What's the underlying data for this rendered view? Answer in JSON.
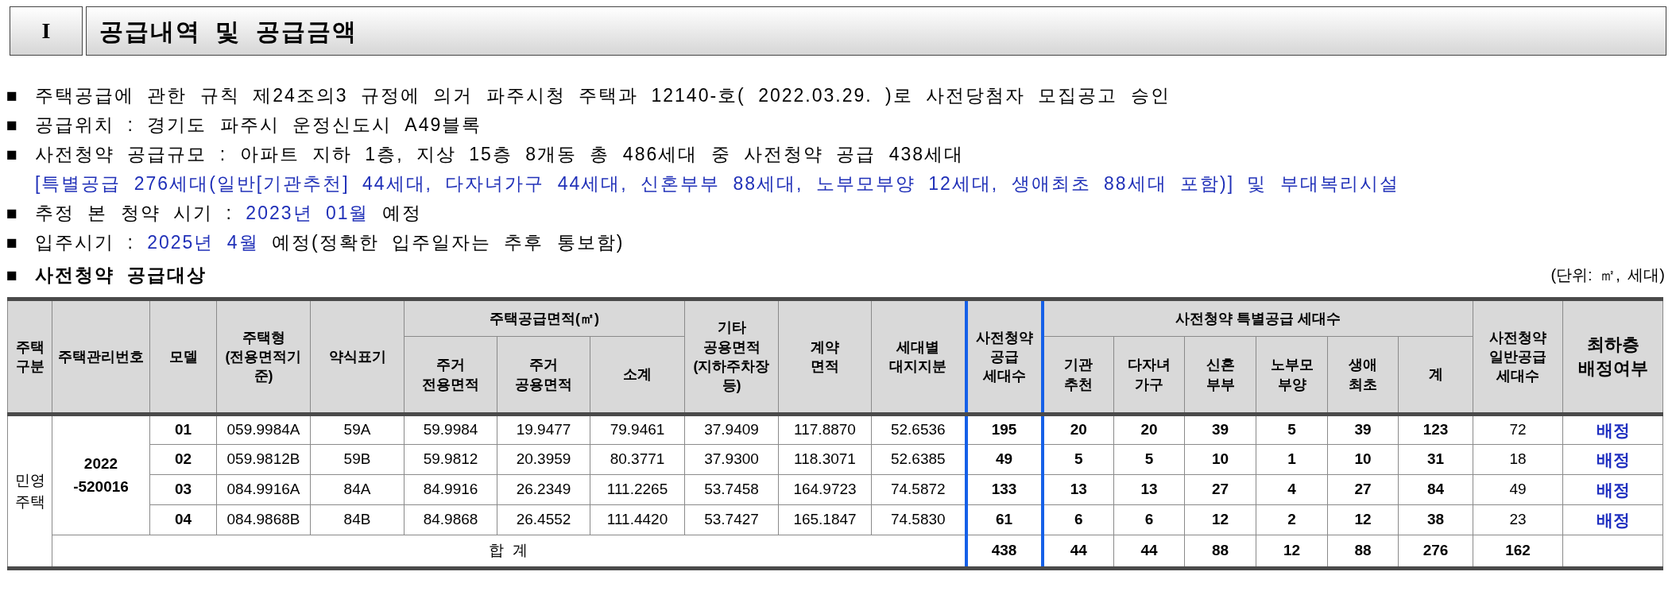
{
  "section": {
    "number": "I",
    "title": "공급내역 및 공급금액"
  },
  "bullets": [
    {
      "marker": "■",
      "segments": [
        {
          "text": "주택공급에 관한 규칙 제24조의3 규정에 의거 파주시청 주택과 12140-호( 2022.03.29. )로 사전당첨자 모집공고 승인",
          "highlight": false
        }
      ]
    },
    {
      "marker": "■",
      "segments": [
        {
          "text": "공급위치 : 경기도 파주시 운정신도시 A49블록",
          "highlight": false
        }
      ]
    },
    {
      "marker": "■",
      "segments": [
        {
          "text": "사전청약 공급규모 : 아파트 지하 1층, 지상 15층 8개동 총 486세대 중 사전청약 공급 438세대",
          "highlight": false
        }
      ]
    },
    {
      "segments": [
        {
          "text": "[특별공급 276세대(일반[기관추천] 44세대, 다자녀가구 44세대, 신혼부부 88세대, 노부모부양 12세대, 생애최초 88세대 포함)]",
          "highlight": true
        },
        {
          "text": " 및 부대복리시설",
          "highlight": true
        }
      ]
    },
    {
      "marker": "■",
      "segments": [
        {
          "text": "추정 본 청약 시기 : ",
          "highlight": false
        },
        {
          "text": "2023년 01월",
          "highlight": true
        },
        {
          "text": " 예정",
          "highlight": false
        }
      ]
    },
    {
      "marker": "■",
      "segments": [
        {
          "text": "입주시기 : ",
          "highlight": false
        },
        {
          "text": "2025년 4월",
          "highlight": true
        },
        {
          "text": " 예정(정확한 입주일자는 추후 통보함)",
          "highlight": false
        }
      ]
    }
  ],
  "subsection": {
    "marker": "■",
    "title": "사전청약 공급대상",
    "unit": "(단위: ㎡, 세대)"
  },
  "table": {
    "header": [
      {
        "text": "주택\n구분",
        "emphasized": false,
        "large": false
      },
      {
        "text": "주택관리번호",
        "emphasized": false,
        "large": false
      },
      {
        "text": "모델",
        "emphasized": false,
        "large": false
      },
      {
        "text": "주택형\n(전용면적기\n준)",
        "emphasized": false,
        "large": false
      },
      {
        "text": "약식표기",
        "emphasized": false,
        "large": false
      },
      {
        "text": "주택공급면적(㎡)",
        "emphasized": false,
        "large": false,
        "subcolumns": [
          {
            "text": "주거\n전용면적"
          },
          {
            "text": "주거\n공용면적"
          },
          {
            "text": "소계"
          }
        ]
      },
      {
        "text": "기타\n공용면적\n(지하주차장\n등)",
        "emphasized": false,
        "large": false
      },
      {
        "text": "계약\n면적",
        "emphasized": false,
        "large": false
      },
      {
        "text": "세대별\n대지지분",
        "emphasized": false,
        "large": false
      },
      {
        "text": "사전청약\n공급\n세대수",
        "emphasized": true,
        "large": false
      },
      {
        "text": "사전청약 특별공급 세대수",
        "emphasized": false,
        "large": false,
        "subcolumns": [
          {
            "text": "기관\n추천"
          },
          {
            "text": "다자녀\n가구"
          },
          {
            "text": "신혼\n부부"
          },
          {
            "text": "노부모\n부양"
          },
          {
            "text": "생애\n최초"
          },
          {
            "text": "계"
          }
        ]
      },
      {
        "text": "사전청약\n일반공급\n세대수",
        "emphasized": false,
        "large": false
      },
      {
        "text": "최하층\n배정여부",
        "emphasized": false,
        "large": true
      }
    ],
    "housing_type": "민영 주택",
    "management_number": "2022\n-520016",
    "rows": [
      [
        "01",
        "059.9984A",
        "59A",
        "59.9984",
        "19.9477",
        "79.9461",
        "37.9409",
        "117.8870",
        "52.6536",
        "195",
        "20",
        "20",
        "39",
        "5",
        "39",
        "123",
        "72",
        "배정"
      ],
      [
        "02",
        "059.9812B",
        "59B",
        "59.9812",
        "20.3959",
        "80.3771",
        "37.9300",
        "118.3071",
        "52.6385",
        "49",
        "5",
        "5",
        "10",
        "1",
        "10",
        "31",
        "18",
        "배정"
      ],
      [
        "03",
        "084.9916A",
        "84A",
        "84.9916",
        "26.2349",
        "111.2265",
        "53.7458",
        "164.9723",
        "74.5872",
        "133",
        "13",
        "13",
        "27",
        "4",
        "27",
        "84",
        "49",
        "배정"
      ],
      [
        "04",
        "084.9868B",
        "84B",
        "84.9868",
        "26.4552",
        "111.4420",
        "53.7427",
        "165.1847",
        "74.5830",
        "61",
        "6",
        "6",
        "12",
        "2",
        "12",
        "38",
        "23",
        "배정"
      ]
    ],
    "total": {
      "label": "합 계",
      "values": [
        "438",
        "44",
        "44",
        "88",
        "12",
        "88",
        "276",
        "162"
      ]
    }
  }
}
